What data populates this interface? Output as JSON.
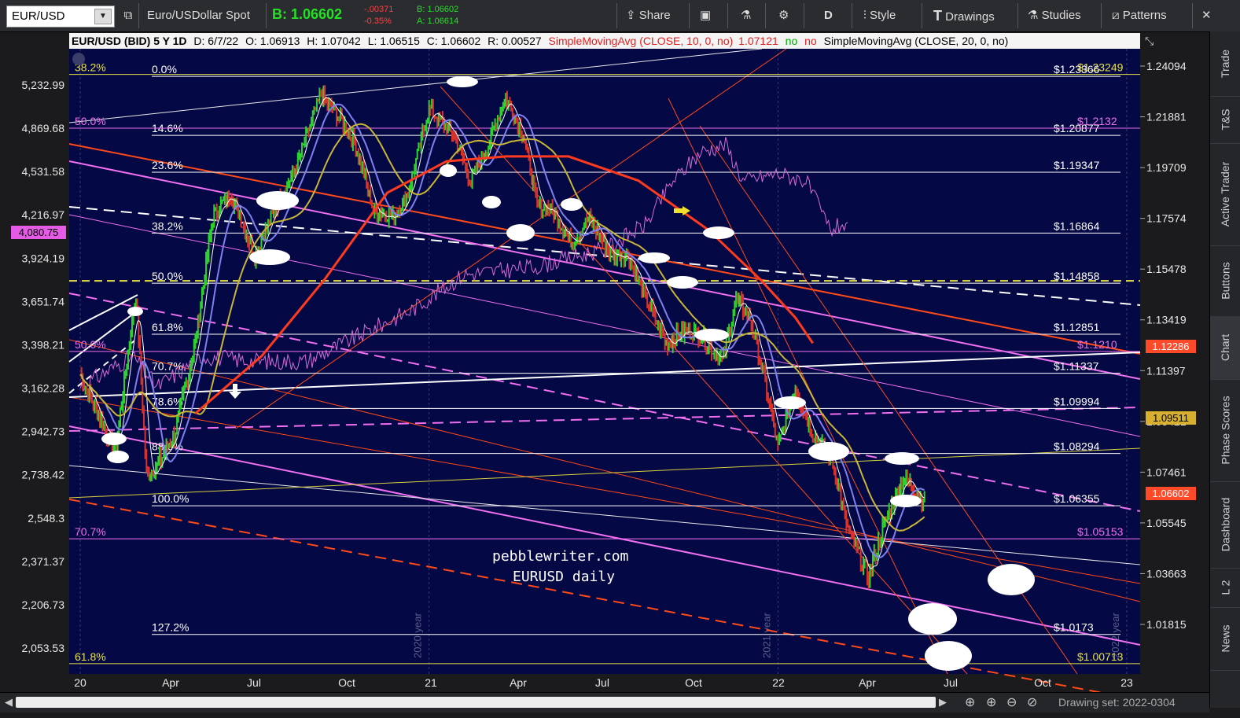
{
  "toolbar": {
    "symbol": "EUR/USD",
    "description": "Euro/USDollar Spot",
    "bid": "B: 1.06602",
    "change": "-.00371",
    "change_pct": "-0.35%",
    "bid_small": "B: 1.06602",
    "ask_small": "A: 1.06614",
    "share": "Share",
    "period": "D",
    "style": "Style",
    "drawings": "Drawings",
    "studies": "Studies",
    "patterns": "Patterns"
  },
  "header": {
    "title": "EUR/USD (BID) 5 Y 1D",
    "date": "D: 6/7/22",
    "open": "O: 1.06913",
    "high": "H: 1.07042",
    "low": "L: 1.06515",
    "close": "C: 1.06602",
    "range": "R: 0.00527",
    "sma10": "SimpleMovingAvg (CLOSE, 10, 0, no)",
    "sma10_val": "1.07121",
    "yes": "no",
    "no": "no",
    "sma20": "SimpleMovingAvg (CLOSE, 20, 0, no)"
  },
  "right_tabs": [
    "Trade",
    "T&S",
    "Active Trader",
    "Buttons",
    "Chart",
    "Phase Scores",
    "Dashboard",
    "L 2",
    "News"
  ],
  "bottom": {
    "drawing_set": "Drawing set: 2022-0304"
  },
  "watermark": {
    "line1": "pebblewriter.com",
    "line2": "EURUSD daily"
  },
  "colors": {
    "bg": "#040844",
    "price_up": "#2fd12f",
    "price_down": "#d8322c",
    "sma10": "#ffffff",
    "sma20": "#7f80f0",
    "sma50": "#c9b536",
    "sma200": "#ff3b1f",
    "overlay": "#d86ad8",
    "fib": "#ffffff",
    "fib_magenta": "#f070f0",
    "fib_yellow": "#e6e04a"
  },
  "chart_data": {
    "type": "line",
    "title": "EUR/USD (BID) 5 Y 1D",
    "x_ticks": [
      "20",
      "Apr",
      "Jul",
      "Oct",
      "21",
      "Apr",
      "Jul",
      "Oct",
      "22",
      "Apr",
      "Jul",
      "Oct",
      "23"
    ],
    "year_marks": [
      "2020 year",
      "2021 year",
      "2022 year"
    ],
    "y_right_ticks": [
      "1.24094",
      "1.21881",
      "1.19709",
      "1.17574",
      "1.15478",
      "1.13419",
      "1.11397",
      "1.09421",
      "1.07461",
      "1.05545",
      "1.03663",
      "1.01815"
    ],
    "y_left_ticks": [
      "5,232.99",
      "4,869.68",
      "4,531.58",
      "4,216.97",
      "3,924.19",
      "3,651.74",
      "3,398.21",
      "3,162.28",
      "2,942.73",
      "2,738.42",
      "2,548.3",
      "2,371.37",
      "2,206.73",
      "2,053.53"
    ],
    "left_marker": "4,080.75",
    "price_markers": [
      {
        "label": "1.12286",
        "color": "#ff4a2a"
      },
      {
        "label": "1.09511",
        "color": "#c9a430"
      },
      {
        "label": "1.06602",
        "color": "#ff4a2a"
      }
    ],
    "fib_levels": [
      {
        "pct": "0.0%",
        "price": "$1.23366",
        "value": 1.23366
      },
      {
        "pct": "14.6%",
        "price": "$1.20877",
        "value": 1.20877
      },
      {
        "pct": "23.6%",
        "price": "$1.19347",
        "value": 1.19347
      },
      {
        "pct": "38.2%",
        "price": "$1.16864",
        "value": 1.16864
      },
      {
        "pct": "50.0%",
        "price": "$1.14858",
        "value": 1.14858
      },
      {
        "pct": "61.8%",
        "price": "$1.12851",
        "value": 1.12851
      },
      {
        "pct": "70.7%",
        "price": "$1.11337",
        "value": 1.11337
      },
      {
        "pct": "78.6%",
        "price": "$1.09994",
        "value": 1.09994
      },
      {
        "pct": "88.6%",
        "price": "$1.08294",
        "value": 1.08294
      },
      {
        "pct": "100.0%",
        "price": "$1.06355",
        "value": 1.06355
      },
      {
        "pct": "127.2%",
        "price": "$1.0173",
        "value": 1.0173
      }
    ],
    "other_levels": [
      {
        "pct": "38.2%",
        "price": "$1.23249",
        "value": 1.2345,
        "color": "yellow"
      },
      {
        "pct": "50.0%",
        "price": "$1.2132",
        "value": 1.2118,
        "color": "magenta"
      },
      {
        "pct": "50.0%",
        "price": "$1.1210",
        "value": 1.1218,
        "color": "magenta"
      },
      {
        "pct": "70.7%",
        "price": "$1.05153",
        "value": 1.0515,
        "color": "magenta"
      },
      {
        "pct": "61.8%",
        "price": "$1.00713",
        "value": 1.0071,
        "color": "yellow"
      }
    ],
    "series": [
      {
        "name": "SimpleMovingAvg (CLOSE, 10, 0, no)"
      },
      {
        "name": "SimpleMovingAvg (CLOSE, 20, 0, no)"
      }
    ],
    "ohlc_key_points": [
      {
        "x": 0.0,
        "y": 1.113
      },
      {
        "x": 0.06,
        "y": 1.095
      },
      {
        "x": 0.1,
        "y": 1.083
      },
      {
        "x": 0.16,
        "y": 1.145
      },
      {
        "x": 0.19,
        "y": 1.075
      },
      {
        "x": 0.22,
        "y": 1.078
      },
      {
        "x": 0.27,
        "y": 1.09
      },
      {
        "x": 0.33,
        "y": 1.125
      },
      {
        "x": 0.38,
        "y": 1.175
      },
      {
        "x": 0.43,
        "y": 1.185
      },
      {
        "x": 0.5,
        "y": 1.16
      },
      {
        "x": 0.57,
        "y": 1.182
      },
      {
        "x": 0.62,
        "y": 1.196
      },
      {
        "x": 0.69,
        "y": 1.226
      },
      {
        "x": 0.75,
        "y": 1.215
      },
      {
        "x": 0.79,
        "y": 1.205
      },
      {
        "x": 0.84,
        "y": 1.178
      },
      {
        "x": 0.9,
        "y": 1.175
      },
      {
        "x": 0.94,
        "y": 1.185
      },
      {
        "x": 1.0,
        "y": 1.22
      },
      {
        "x": 1.07,
        "y": 1.209
      },
      {
        "x": 1.12,
        "y": 1.19
      },
      {
        "x": 1.17,
        "y": 1.205
      },
      {
        "x": 1.22,
        "y": 1.225
      },
      {
        "x": 1.27,
        "y": 1.209
      },
      {
        "x": 1.31,
        "y": 1.18
      },
      {
        "x": 1.35,
        "y": 1.178
      },
      {
        "x": 1.41,
        "y": 1.165
      },
      {
        "x": 1.46,
        "y": 1.175
      },
      {
        "x": 1.52,
        "y": 1.16
      },
      {
        "x": 1.57,
        "y": 1.16
      },
      {
        "x": 1.61,
        "y": 1.146
      },
      {
        "x": 1.68,
        "y": 1.125
      },
      {
        "x": 1.74,
        "y": 1.13
      },
      {
        "x": 1.78,
        "y": 1.128
      },
      {
        "x": 1.84,
        "y": 1.118
      },
      {
        "x": 1.88,
        "y": 1.142
      },
      {
        "x": 1.92,
        "y": 1.135
      },
      {
        "x": 1.96,
        "y": 1.112
      },
      {
        "x": 2.0,
        "y": 1.085
      },
      {
        "x": 2.05,
        "y": 1.108
      },
      {
        "x": 2.1,
        "y": 1.09
      },
      {
        "x": 2.15,
        "y": 1.083
      },
      {
        "x": 2.2,
        "y": 1.055
      },
      {
        "x": 2.26,
        "y": 1.038
      },
      {
        "x": 2.3,
        "y": 1.055
      },
      {
        "x": 2.36,
        "y": 1.074
      },
      {
        "x": 2.42,
        "y": 1.066
      }
    ],
    "sma200_points": [
      {
        "x": 0.33,
        "y": 1.098
      },
      {
        "x": 0.52,
        "y": 1.12
      },
      {
        "x": 0.7,
        "y": 1.15
      },
      {
        "x": 0.88,
        "y": 1.185
      },
      {
        "x": 1.05,
        "y": 1.198
      },
      {
        "x": 1.22,
        "y": 1.2
      },
      {
        "x": 1.4,
        "y": 1.2
      },
      {
        "x": 1.6,
        "y": 1.19
      },
      {
        "x": 1.8,
        "y": 1.17
      },
      {
        "x": 1.95,
        "y": 1.15
      },
      {
        "x": 2.05,
        "y": 1.135
      },
      {
        "x": 2.1,
        "y": 1.125
      }
    ],
    "overlay_points": [
      {
        "x": 0.0,
        "y": 1.108
      },
      {
        "x": 0.15,
        "y": 1.12
      },
      {
        "x": 0.22,
        "y": 1.108
      },
      {
        "x": 0.35,
        "y": 1.12
      },
      {
        "x": 0.5,
        "y": 1.118
      },
      {
        "x": 0.65,
        "y": 1.118
      },
      {
        "x": 0.8,
        "y": 1.128
      },
      {
        "x": 0.95,
        "y": 1.138
      },
      {
        "x": 1.1,
        "y": 1.152
      },
      {
        "x": 1.3,
        "y": 1.155
      },
      {
        "x": 1.5,
        "y": 1.162
      },
      {
        "x": 1.62,
        "y": 1.172
      },
      {
        "x": 1.7,
        "y": 1.19
      },
      {
        "x": 1.78,
        "y": 1.202
      },
      {
        "x": 1.85,
        "y": 1.205
      },
      {
        "x": 1.9,
        "y": 1.19
      },
      {
        "x": 2.0,
        "y": 1.193
      },
      {
        "x": 2.08,
        "y": 1.19
      },
      {
        "x": 2.15,
        "y": 1.17
      },
      {
        "x": 2.2,
        "y": 1.173
      }
    ],
    "x_domain_note": "x in years from Jan 2020 (0) to Jan 2023 (3)",
    "xlim": [
      0,
      3
    ],
    "ylim": [
      1.0035,
      1.2455
    ],
    "projection_targets": [
      1.03663,
      1.0195,
      1.006
    ]
  }
}
